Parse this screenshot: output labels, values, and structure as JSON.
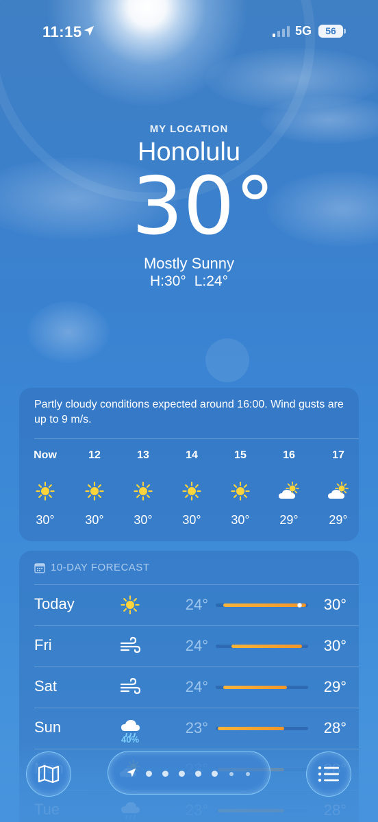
{
  "status_bar": {
    "time": "11:15",
    "network": "5G",
    "battery": "56"
  },
  "location": {
    "label": "MY LOCATION",
    "city": "Honolulu"
  },
  "current": {
    "temp": "30°",
    "condition": "Mostly Sunny",
    "high": "H:30°",
    "low": "L:24°"
  },
  "hourly": {
    "summary": "Partly cloudy conditions expected around 16:00. Wind gusts are up to 9 m/s.",
    "hours": [
      {
        "label": "Now",
        "icon": "sun-icon",
        "temp": "30°"
      },
      {
        "label": "12",
        "icon": "sun-icon",
        "temp": "30°"
      },
      {
        "label": "13",
        "icon": "sun-icon",
        "temp": "30°"
      },
      {
        "label": "14",
        "icon": "sun-icon",
        "temp": "30°"
      },
      {
        "label": "15",
        "icon": "sun-icon",
        "temp": "30°"
      },
      {
        "label": "16",
        "icon": "partly-cloudy-icon",
        "temp": "29°"
      },
      {
        "label": "17",
        "icon": "partly-cloudy-icon",
        "temp": "29°"
      }
    ]
  },
  "daily": {
    "header": "10-DAY FORECAST",
    "days": [
      {
        "day": "Today",
        "icon": "sun-icon",
        "precip": "",
        "low": "24°",
        "high": "30°",
        "range_start": 0.08,
        "range_end": 0.98,
        "current_marker": 0.9
      },
      {
        "day": "Fri",
        "icon": "wind-icon",
        "precip": "",
        "low": "24°",
        "high": "30°",
        "range_start": 0.17,
        "range_end": 0.93
      },
      {
        "day": "Sat",
        "icon": "wind-icon",
        "precip": "",
        "low": "24°",
        "high": "29°",
        "range_start": 0.08,
        "range_end": 0.77
      },
      {
        "day": "Sun",
        "icon": "rain-cloud-icon",
        "precip": "40%",
        "low": "23°",
        "high": "28°",
        "range_start": 0.02,
        "range_end": 0.74
      },
      {
        "day": "Mon",
        "icon": "partly-cloudy-icon",
        "precip": "",
        "low": "23°",
        "high": "28°",
        "range_start": 0.02,
        "range_end": 0.74
      },
      {
        "day": "Tue",
        "icon": "rain-cloud-icon",
        "precip": "",
        "low": "23°",
        "high": "28°",
        "range_start": 0.02,
        "range_end": 0.74
      }
    ]
  },
  "bottom_bar": {
    "map_icon": "map-icon",
    "list_icon": "list-icon",
    "page_count": 7
  }
}
